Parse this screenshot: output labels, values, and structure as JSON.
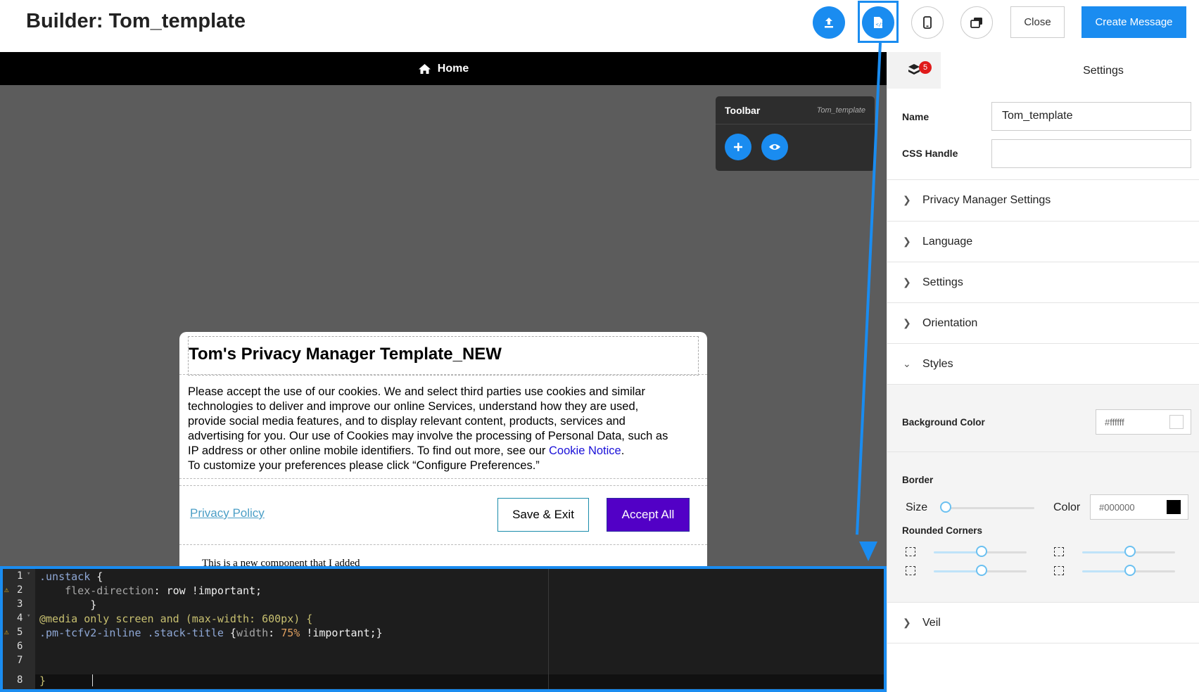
{
  "header": {
    "title": "Builder: Tom_template",
    "close_label": "Close",
    "create_label": "Create Message",
    "icons": [
      "upload-icon",
      "code-file-icon",
      "mobile-icon",
      "layers-icon"
    ]
  },
  "canvas": {
    "home_label": "Home",
    "toolbar": {
      "title": "Toolbar",
      "subtitle": "Tom_template",
      "icons": [
        "plus-icon",
        "eye-icon"
      ]
    }
  },
  "message": {
    "title": "Tom's Privacy Manager Template_NEW",
    "body_lines": [
      "Please accept the use of our cookies. We and select third parties use cookies and similar",
      "technologies to deliver and improve our online Services, understand how they are used,",
      "provide social media features, and to display relevant content, products, services and",
      "advertising for you. Our use of Cookies may involve the processing of Personal Data, such as",
      "IP address or other online mobile identifiers. To find out more, see our "
    ],
    "cookie_link": "Cookie Notice",
    "body_period": ".",
    "body_last": "To customize your preferences please click “Configure Preferences.”",
    "privacy_link": "Privacy Policy",
    "save_label": "Save & Exit",
    "accept_label": "Accept All",
    "component_text": "This is a new component that I added"
  },
  "editor": {
    "line_numbers": [
      "1",
      "2",
      "3",
      "4",
      "5",
      "6",
      "7",
      "8"
    ],
    "warnings": [
      2,
      5
    ],
    "code": {
      "l1_sel": ".unstack",
      "l1_brace": " {",
      "l2_prop": "    flex-direction",
      "l2_val": ": row !important;",
      "l3": "        }",
      "l4": "@media only screen and (max-width: 600px) {",
      "l5_sel": ".pm-tcfv2-inline .stack-title",
      "l5_a": " {",
      "l5_prop": "width",
      "l5_b": ": ",
      "l5_num": "75%",
      "l5_c": " !important;}",
      "l8": "}"
    }
  },
  "panel": {
    "tab_badge": "5",
    "tab_label": "Settings",
    "name_label": "Name",
    "name_value": "Tom_template",
    "css_label": "CSS Handle",
    "css_value": "",
    "sections": [
      "Privacy Manager Settings",
      "Language",
      "Settings",
      "Orientation",
      "Styles",
      "Veil"
    ],
    "styles": {
      "bg_label": "Background Color",
      "bg_value": "#ffffff",
      "border_label": "Border",
      "size_label": "Size",
      "color_label": "Color",
      "border_color": "#000000",
      "border_size": 0,
      "corners_label": "Rounded Corners",
      "corner_values": [
        0.5,
        0.5,
        0.5,
        0.5
      ]
    }
  },
  "colors": {
    "accent": "#1a8cf0",
    "accept_button": "#5200c6",
    "badge": "#e01b1b"
  }
}
